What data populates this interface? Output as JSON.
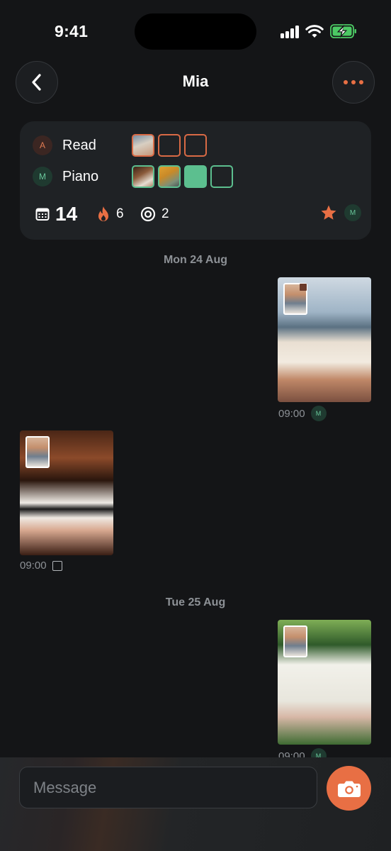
{
  "status_bar": {
    "time": "9:41"
  },
  "header": {
    "title": "Mia"
  },
  "summary": {
    "habits": [
      {
        "avatar": "A",
        "name": "Read"
      },
      {
        "avatar": "M",
        "name": "Piano"
      }
    ],
    "days_count": "14",
    "streak": "6",
    "goals": "2",
    "partner_avatar": "M"
  },
  "feed": {
    "days": [
      {
        "label": "Mon 24 Aug"
      },
      {
        "label": "Tue 25 Aug"
      }
    ],
    "messages": [
      {
        "time": "09:00",
        "avatar": "M",
        "side": "right",
        "habit": "Read"
      },
      {
        "time": "09:00",
        "side": "left",
        "habit": "Piano"
      },
      {
        "time": "09:00",
        "avatar": "M",
        "side": "right",
        "habit": "Read"
      }
    ]
  },
  "composer": {
    "placeholder": "Message"
  },
  "colors": {
    "accent": "#e86f44",
    "green": "#5cbf8f",
    "background": "#141517"
  },
  "icons": [
    "back-chevron-icon",
    "more-dots-icon",
    "calendar-icon",
    "fire-icon",
    "target-icon",
    "star-icon",
    "camera-icon"
  ]
}
